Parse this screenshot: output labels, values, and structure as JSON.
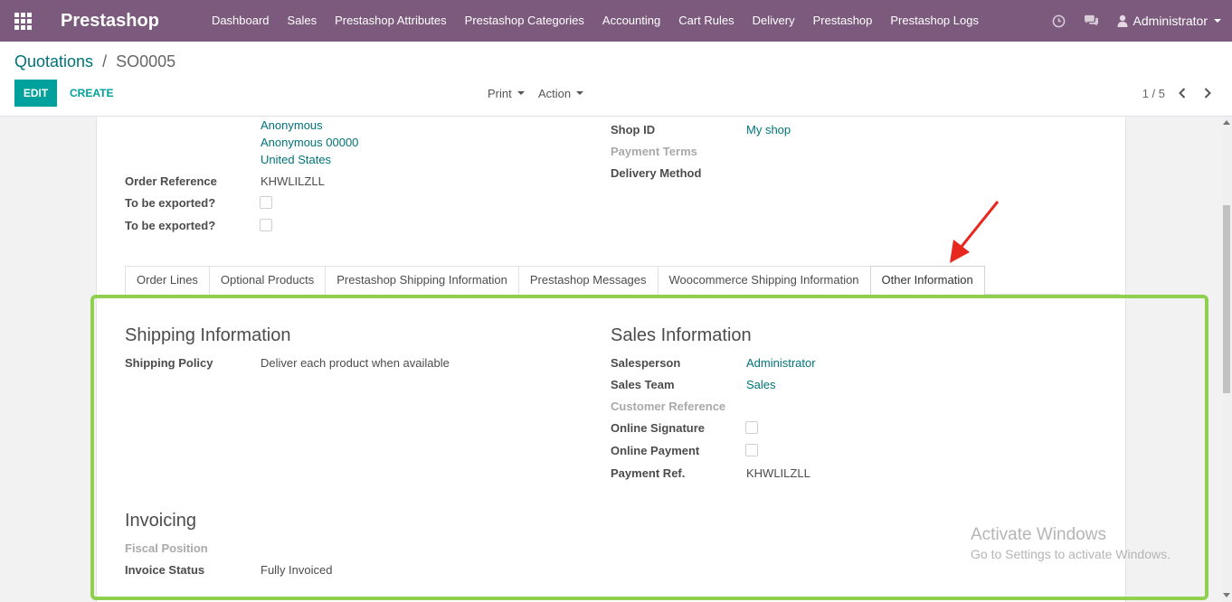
{
  "navbar": {
    "brand": "Prestashop",
    "menu": [
      "Dashboard",
      "Sales",
      "Prestashop Attributes",
      "Prestashop Categories",
      "Accounting",
      "Cart Rules",
      "Delivery",
      "Prestashop",
      "Prestashop Logs"
    ],
    "user": "Administrator"
  },
  "breadcrumb": {
    "parent": "Quotations",
    "separator": "/",
    "current": "SO0005"
  },
  "toolbar": {
    "edit": "EDIT",
    "create": "CREATE",
    "print": "Print",
    "action": "Action",
    "pager": "1 / 5"
  },
  "form": {
    "address": [
      "Anonymous",
      "Anonymous 00000",
      "United States"
    ],
    "order_reference": {
      "label": "Order Reference",
      "value": "KHWLILZLL"
    },
    "to_be_exported_1": {
      "label": "To be exported?"
    },
    "to_be_exported_2": {
      "label": "To be exported?"
    },
    "shop_id": {
      "label": "Shop ID",
      "value": "My shop"
    },
    "payment_terms": {
      "label": "Payment Terms"
    },
    "delivery_method": {
      "label": "Delivery Method"
    }
  },
  "tabs": [
    "Order Lines",
    "Optional Products",
    "Prestashop Shipping Information",
    "Prestashop Messages",
    "Woocommerce Shipping Information",
    "Other Information"
  ],
  "active_tab": "Other Information",
  "shipping": {
    "title": "Shipping Information",
    "policy_label": "Shipping Policy",
    "policy_value": "Deliver each product when available"
  },
  "sales": {
    "title": "Sales Information",
    "salesperson_label": "Salesperson",
    "salesperson_value": "Administrator",
    "team_label": "Sales Team",
    "team_value": "Sales",
    "customer_ref_label": "Customer Reference",
    "online_signature_label": "Online Signature",
    "online_payment_label": "Online Payment",
    "payment_ref_label": "Payment Ref.",
    "payment_ref_value": "KHWLILZLL"
  },
  "invoicing": {
    "title": "Invoicing",
    "fiscal_label": "Fiscal Position",
    "status_label": "Invoice Status",
    "status_value": "Fully Invoiced"
  },
  "watermark": {
    "line1": "Activate Windows",
    "line2": "Go to Settings to activate Windows."
  },
  "colors": {
    "navbar": "#7c5a7d",
    "accent": "#00a09d",
    "link": "#00737a",
    "highlight": "#8fd14f",
    "arrow": "#e8271f"
  }
}
